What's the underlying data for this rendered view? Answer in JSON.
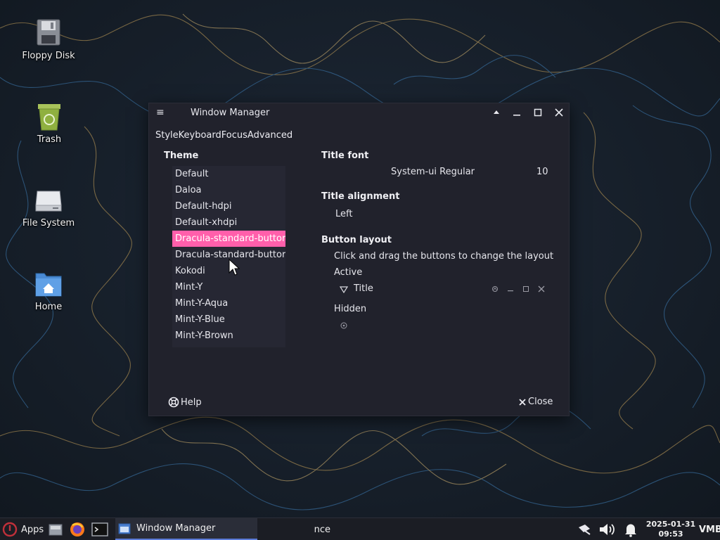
{
  "desktop": {
    "icons": [
      {
        "label": "Floppy Disk",
        "icon": "floppy-disk-icon"
      },
      {
        "label": "Trash",
        "icon": "trash-icon"
      },
      {
        "label": "File System",
        "icon": "drive-icon"
      },
      {
        "label": "Home",
        "icon": "home-folder-icon"
      }
    ]
  },
  "window": {
    "title": "Window Manager",
    "tabs": [
      "Style",
      "Keyboard",
      "Focus",
      "Advanced"
    ],
    "theme": {
      "heading": "Theme",
      "items": [
        "Default",
        "Daloa",
        "Default-hdpi",
        "Default-xhdpi",
        "Dracula-standard-buttor",
        "Dracula-standard-buttor",
        "Kokodi",
        "Mint-Y",
        "Mint-Y-Aqua",
        "Mint-Y-Blue",
        "Mint-Y-Brown"
      ],
      "selected_index": 4
    },
    "title_font": {
      "heading": "Title font",
      "font_name": "System-ui Regular",
      "font_size": "10"
    },
    "title_alignment": {
      "heading": "Title alignment",
      "value": "Left"
    },
    "button_layout": {
      "heading": "Button layout",
      "hint": "Click and drag the buttons to change the layout",
      "active_label": "Active",
      "title_item": "Title",
      "hidden_label": "Hidden"
    },
    "footer": {
      "help": "Help",
      "close": "Close"
    }
  },
  "taskbar": {
    "apps_label": "Apps",
    "active_task": "Window Manager",
    "second_task_fragment": "nce",
    "clock_date": "2025-01-31",
    "clock_time": "09:53",
    "tray_text": "VMB"
  },
  "colors": {
    "accent_selected": "#ff5fab",
    "window_bg": "#21222c",
    "list_bg": "#262733",
    "taskbar_bg": "#1b1d24",
    "task_underline": "#5b7bd8"
  }
}
